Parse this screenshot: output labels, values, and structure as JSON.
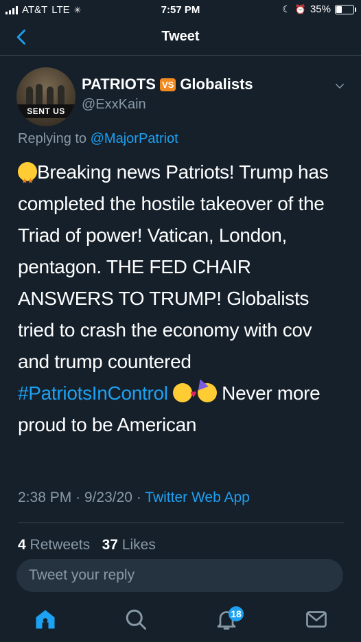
{
  "status_bar": {
    "carrier": "AT&T",
    "network": "LTE",
    "time": "7:57 PM",
    "battery": "35%",
    "battery_level": 0.35
  },
  "nav": {
    "title": "Tweet"
  },
  "tweet": {
    "display_name_left": "PATRIOTS",
    "badge": "VS",
    "display_name_right": "Globalists",
    "handle": "@ExxKain",
    "avatar_text": "SENT US",
    "replying_prefix": "Replying to",
    "replying_to": "@MajorPatriot",
    "body_part1": "Breaking news Patriots! Trump has completed the hostile takeover of the Triad of power! Vatican, London, pentagon. THE FED CHAIR ANSWERS TO TRUMP! Globalists tried to crash the economy with cov and trump countered",
    "hashtag": "#PatriotsInControl",
    "body_part2": "Never more proud to be American",
    "time": "2:38 PM",
    "date": "9/23/20",
    "source": "Twitter Web App",
    "retweets": "4",
    "retweets_label": "Retweets",
    "likes": "37",
    "likes_label": "Likes"
  },
  "reply": {
    "placeholder": "Tweet your reply"
  },
  "tabs": {
    "notifications_badge": "18"
  },
  "colors": {
    "background": "#15202b",
    "accent": "#1da1f2",
    "muted": "#8899a6",
    "badge_orange": "#f28a22"
  },
  "icons": [
    "back-chevron-icon",
    "chevron-down-icon",
    "home-icon",
    "search-icon",
    "notifications-bell-icon",
    "messages-envelope-icon"
  ]
}
